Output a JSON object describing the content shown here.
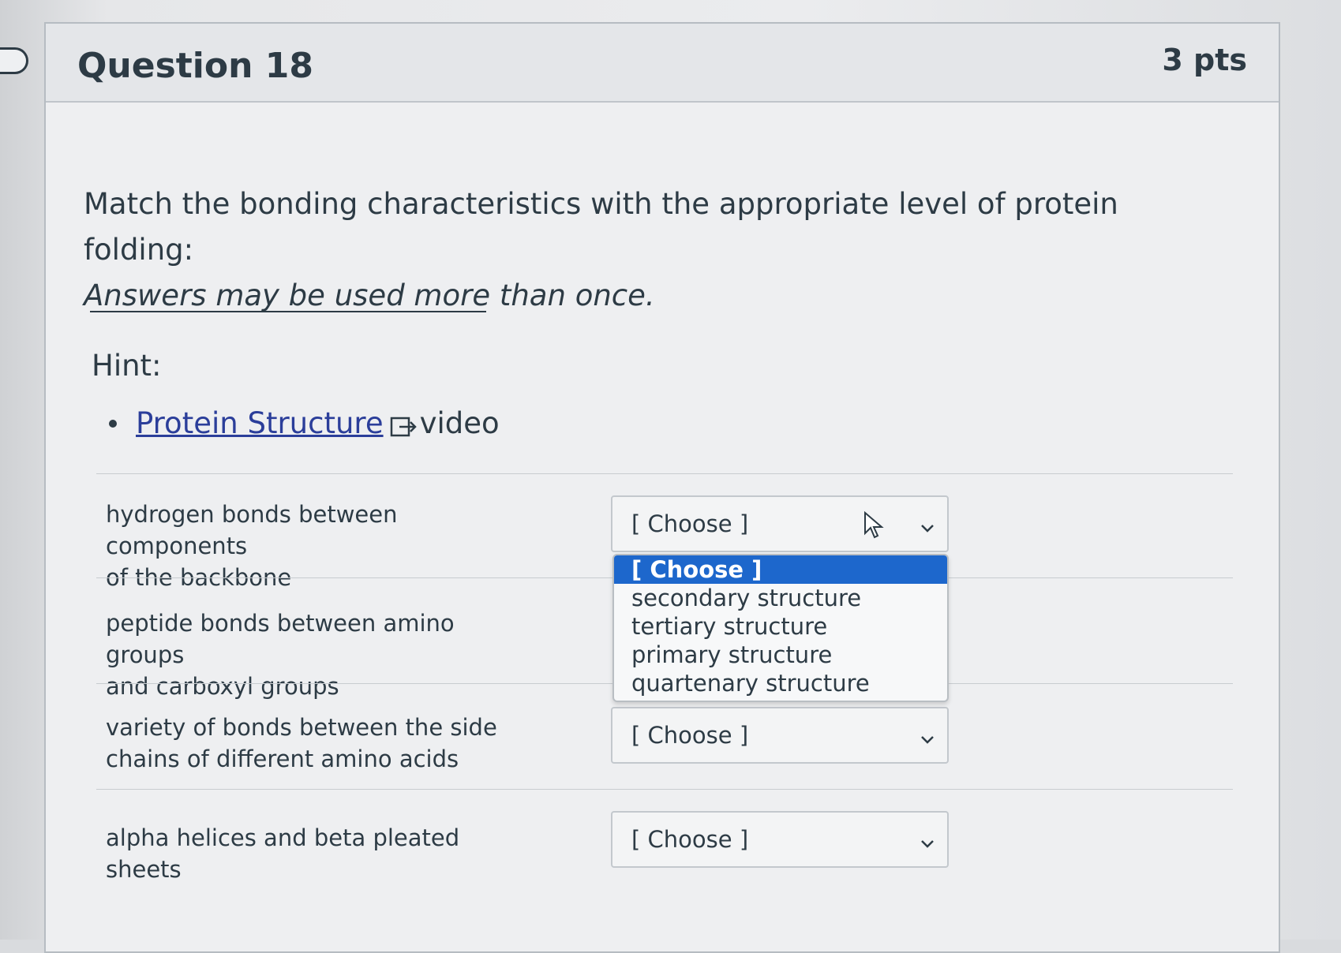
{
  "question": {
    "title": "Question 18",
    "points": "3 pts",
    "prompt": "Match the bonding characteristics with the appropriate level of protein folding:",
    "prompt_note": "Answers may be used more than once.",
    "hint_label": "Hint:",
    "hint_link": "Protein Structure",
    "hint_link_suffix": "video"
  },
  "matches": [
    {
      "label_line1": "hydrogen bonds between components",
      "label_line2": "of the backbone",
      "selected": "[ Choose ]"
    },
    {
      "label_line1": "peptide bonds between amino groups",
      "label_line2": "and carboxyl groups",
      "selected": "[ Choose ]"
    },
    {
      "label_line1": "variety of bonds between the side",
      "label_line2": "chains of different amino acids",
      "selected": "[ Choose ]"
    },
    {
      "label_line1": "alpha helices and beta pleated sheets",
      "label_line2": "",
      "selected": "[ Choose ]"
    }
  ],
  "dropdown": {
    "options": [
      "[ Choose ]",
      "secondary structure",
      "tertiary structure",
      "primary structure",
      "quartenary structure"
    ],
    "highlighted_index": 0
  },
  "icons": {
    "external_link": "external-link-icon",
    "dropdown_arrow": "chevron-down-icon",
    "mouse_cursor": "mouse-cursor-icon"
  },
  "colors": {
    "link": "#2b3e9a",
    "highlight": "#1d67cc"
  }
}
